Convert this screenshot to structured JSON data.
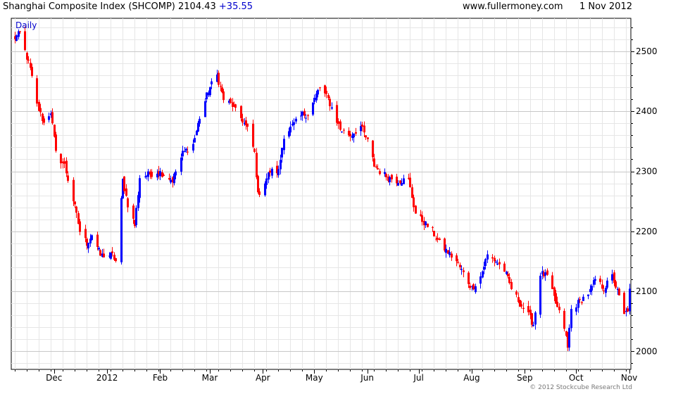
{
  "header": {
    "title": "Shanghai Composite Index (SHCOMP) 2104.43",
    "change": "+35.55",
    "website": "www.fullermoney.com",
    "date": "1 Nov 2012"
  },
  "footer": {
    "copyright": "© 2012 Stockcube Research Ltd"
  },
  "colors": {
    "up": "#0000ff",
    "down": "#ff0000",
    "grid": "#d9d9d9",
    "change": "#0000cc"
  },
  "chart_data": {
    "type": "candlestick",
    "period_label": "Daily",
    "x_tick_labels": [
      "Dec",
      "2012",
      "Feb",
      "Mar",
      "Apr",
      "May",
      "Jun",
      "Jul",
      "Aug",
      "Sep",
      "Oct",
      "Nov"
    ],
    "x_tick_dates": [
      "2011-12-01",
      "2012-01-01",
      "2012-02-01",
      "2012-03-01",
      "2012-04-01",
      "2012-05-01",
      "2012-06-01",
      "2012-07-01",
      "2012-08-01",
      "2012-09-01",
      "2012-10-01",
      "2012-11-01"
    ],
    "x_range": [
      "2011-11-06",
      "2012-11-02"
    ],
    "y_ticks": [
      2000,
      2100,
      2200,
      2300,
      2400,
      2500
    ],
    "ylim": [
      1970,
      2555
    ],
    "y_axis_position": "right",
    "grid": true,
    "anchors": [
      [
        "2011-11-07",
        2520
      ],
      [
        "2011-11-11",
        2530
      ],
      [
        "2011-11-17",
        2470
      ],
      [
        "2011-11-21",
        2410
      ],
      [
        "2011-11-25",
        2380
      ],
      [
        "2011-11-29",
        2400
      ],
      [
        "2011-12-02",
        2330
      ],
      [
        "2011-12-07",
        2310
      ],
      [
        "2011-12-13",
        2240
      ],
      [
        "2011-12-16",
        2200
      ],
      [
        "2011-12-20",
        2180
      ],
      [
        "2011-12-23",
        2195
      ],
      [
        "2011-12-28",
        2160
      ],
      [
        "2012-01-04",
        2160
      ],
      [
        "2012-01-06",
        2150
      ],
      [
        "2012-01-10",
        2285
      ],
      [
        "2012-01-13",
        2245
      ],
      [
        "2012-01-17",
        2210
      ],
      [
        "2012-01-20",
        2290
      ],
      [
        "2012-01-31",
        2300
      ],
      [
        "2012-02-03",
        2295
      ],
      [
        "2012-02-08",
        2285
      ],
      [
        "2012-02-14",
        2330
      ],
      [
        "2012-02-20",
        2345
      ],
      [
        "2012-02-24",
        2390
      ],
      [
        "2012-02-29",
        2435
      ],
      [
        "2012-03-05",
        2460
      ],
      [
        "2012-03-09",
        2420
      ],
      [
        "2012-03-14",
        2410
      ],
      [
        "2012-03-16",
        2400
      ],
      [
        "2012-03-20",
        2385
      ],
      [
        "2012-03-23",
        2370
      ],
      [
        "2012-03-27",
        2330
      ],
      [
        "2012-03-29",
        2260
      ],
      [
        "2012-04-05",
        2300
      ],
      [
        "2012-04-10",
        2300
      ],
      [
        "2012-04-13",
        2360
      ],
      [
        "2012-04-18",
        2375
      ],
      [
        "2012-04-24",
        2395
      ],
      [
        "2012-04-27",
        2395
      ],
      [
        "2012-05-04",
        2440
      ],
      [
        "2012-05-09",
        2420
      ],
      [
        "2012-05-16",
        2370
      ],
      [
        "2012-05-22",
        2360
      ],
      [
        "2012-05-28",
        2375
      ],
      [
        "2012-06-01",
        2350
      ],
      [
        "2012-06-05",
        2310
      ],
      [
        "2012-06-08",
        2300
      ],
      [
        "2012-06-13",
        2290
      ],
      [
        "2012-06-18",
        2285
      ],
      [
        "2012-06-25",
        2285
      ],
      [
        "2012-06-29",
        2230
      ],
      [
        "2012-07-04",
        2215
      ],
      [
        "2012-07-09",
        2200
      ],
      [
        "2012-07-13",
        2180
      ],
      [
        "2012-07-18",
        2165
      ],
      [
        "2012-07-23",
        2150
      ],
      [
        "2012-07-27",
        2130
      ],
      [
        "2012-08-01",
        2105
      ],
      [
        "2012-08-06",
        2125
      ],
      [
        "2012-08-10",
        2160
      ],
      [
        "2012-08-15",
        2150
      ],
      [
        "2012-08-20",
        2135
      ],
      [
        "2012-08-24",
        2105
      ],
      [
        "2012-08-29",
        2080
      ],
      [
        "2012-09-03",
        2060
      ],
      [
        "2012-09-06",
        2045
      ],
      [
        "2012-09-10",
        2130
      ],
      [
        "2012-09-14",
        2125
      ],
      [
        "2012-09-19",
        2080
      ],
      [
        "2012-09-24",
        2040
      ],
      [
        "2012-09-26",
        2005
      ],
      [
        "2012-09-28",
        2070
      ],
      [
        "2012-10-09",
        2100
      ],
      [
        "2012-10-12",
        2120
      ],
      [
        "2012-10-17",
        2105
      ],
      [
        "2012-10-22",
        2125
      ],
      [
        "2012-10-25",
        2100
      ],
      [
        "2012-10-29",
        2060
      ],
      [
        "2012-10-31",
        2070
      ],
      [
        "2012-11-01",
        2104.43
      ]
    ]
  }
}
